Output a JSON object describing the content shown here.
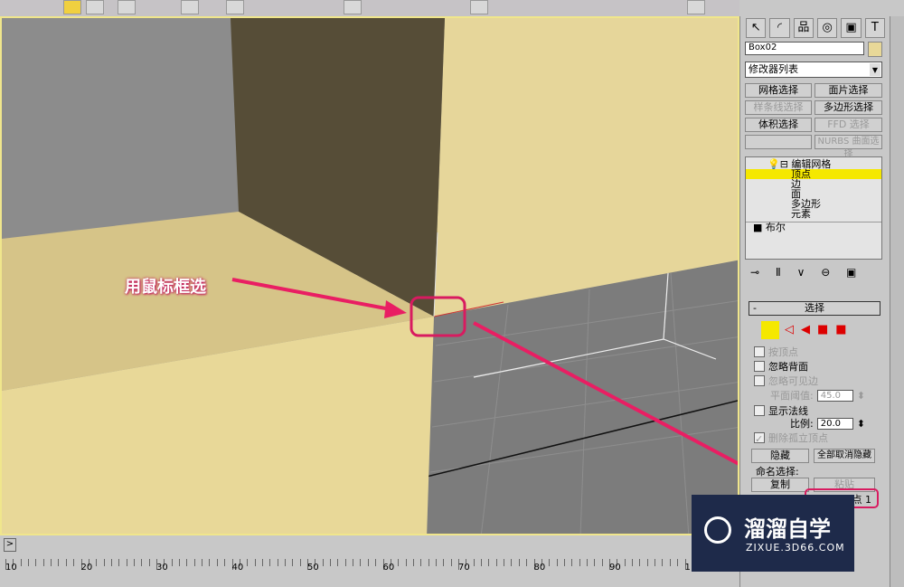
{
  "panel": {
    "object_name": "Box02",
    "modifier_list": "修改器列表",
    "buttons": [
      "网格选择",
      "面片选择",
      "样条线选择",
      "多边形选择",
      "体积选择",
      "FFD 选择",
      "NURBS 曲面选择"
    ],
    "stack": {
      "root": "编辑网格",
      "items": [
        "顶点",
        "边",
        "面",
        "多边形",
        "元素"
      ],
      "boolean": "布尔"
    },
    "rollout_title": "选择",
    "rollout_collapse": "-",
    "checks": [
      "按顶点",
      "忽略背面",
      "忽略可见边",
      "显示法线",
      "删除孤立顶点"
    ],
    "planar_label": "平面阈值:",
    "planar_value": "45.0",
    "scale_label": "比例:",
    "scale_value": "20.0",
    "hide": "隐藏",
    "unhide_all": "全部取消隐藏",
    "named_sel": "命名选择:",
    "copy": "复制",
    "paste": "粘贴",
    "selected_info": "点 1"
  },
  "annotation": "用鼠标框选",
  "timeline": {
    "play_glyph": ">",
    "labels": [
      "10",
      "20",
      "30",
      "40",
      "50",
      "60",
      "70",
      "80",
      "90",
      "1"
    ]
  },
  "watermark": {
    "name": "溜溜自学",
    "url": "ZIXUE.3D66.COM"
  }
}
